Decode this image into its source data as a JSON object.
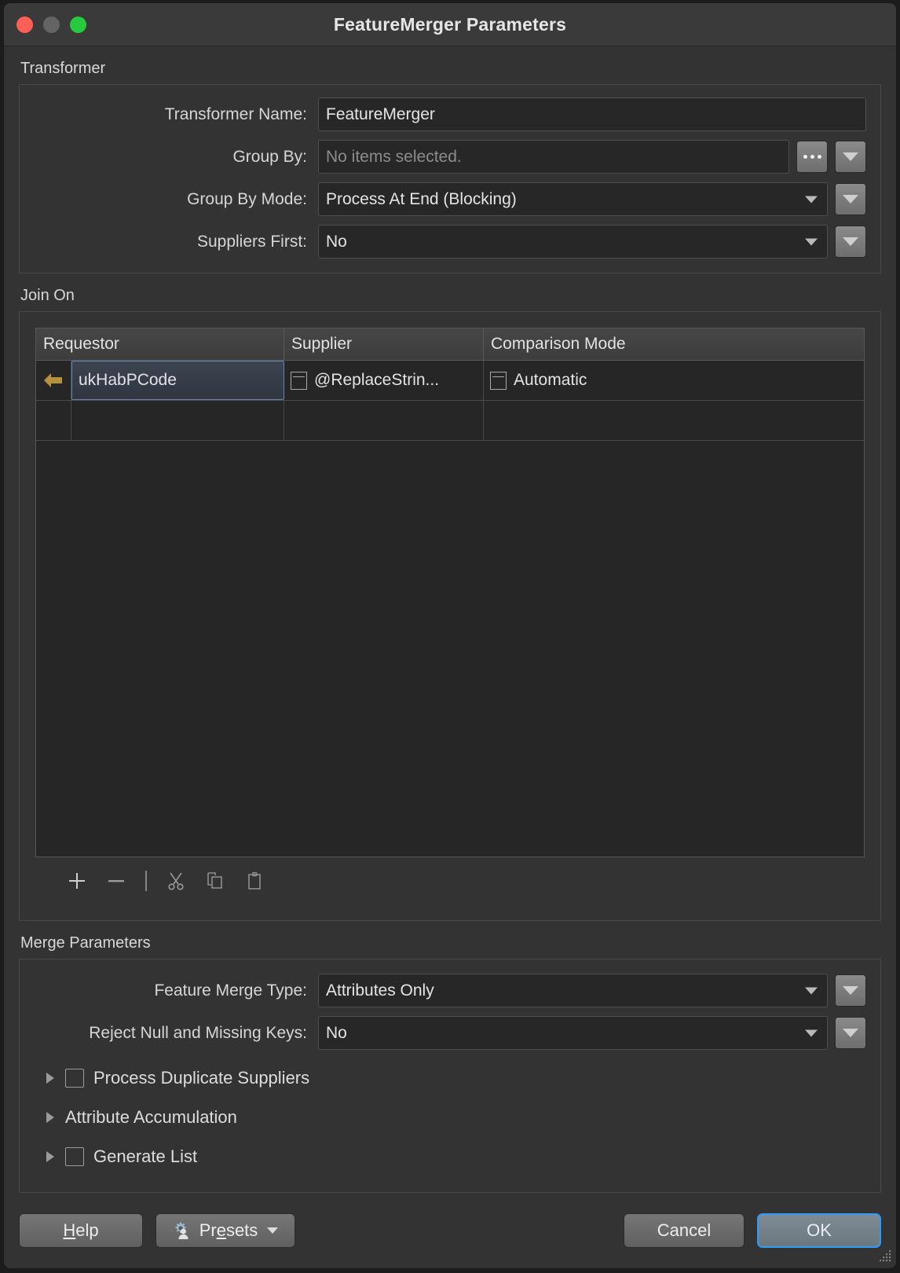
{
  "window": {
    "title": "FeatureMerger Parameters",
    "traffic_lights": [
      "close-button",
      "minimize-button",
      "maximize-button"
    ],
    "accent_focus": "#2f9bf5"
  },
  "transformer": {
    "section_title": "Transformer",
    "fields": [
      {
        "label": "Transformer Name:",
        "value": "FeatureMerger",
        "type": "text"
      },
      {
        "label": "Group By:",
        "value": "",
        "placeholder": "No items selected.",
        "type": "picker",
        "browse_label": "..."
      },
      {
        "label": "Group By Mode:",
        "value": "Process At End (Blocking)",
        "type": "combo"
      },
      {
        "label": "Suppliers First:",
        "value": "No",
        "type": "combo"
      }
    ]
  },
  "join_on": {
    "section_title": "Join On",
    "columns": [
      "Requestor",
      "Supplier",
      "Comparison Mode"
    ],
    "rows": [
      {
        "requestor": "ukHabPCode",
        "supplier": "@ReplaceStrin...",
        "comparison_mode": "Automatic",
        "selected_cell": "requestor",
        "row_marker": "left-arrow-marker"
      }
    ],
    "toolbar": [
      {
        "name": "add-row-button",
        "icon": "plus-icon"
      },
      {
        "name": "remove-row-button",
        "icon": "minus-icon"
      },
      {
        "name": "toolbar-separator",
        "icon": "separator"
      },
      {
        "name": "cut-button",
        "icon": "scissors-icon"
      },
      {
        "name": "copy-button",
        "icon": "copy-icon"
      },
      {
        "name": "paste-button",
        "icon": "clipboard-icon"
      }
    ]
  },
  "merge_parameters": {
    "section_title": "Merge Parameters",
    "fields": [
      {
        "label": "Feature Merge Type:",
        "value": "Attributes Only",
        "type": "combo"
      },
      {
        "label": "Reject Null and Missing Keys:",
        "value": "No",
        "type": "combo"
      }
    ],
    "tree_items": [
      {
        "label": "Process Duplicate Suppliers",
        "checkbox": true,
        "checked": false,
        "expanded": false
      },
      {
        "label": "Attribute Accumulation",
        "checkbox": false,
        "checked": false,
        "expanded": false
      },
      {
        "label": "Generate List",
        "checkbox": true,
        "checked": false,
        "expanded": false
      }
    ]
  },
  "footer": {
    "help_label": "Help",
    "help_mnemonic": "H",
    "presets_label": "Presets",
    "cancel_label": "Cancel",
    "ok_label": "OK"
  }
}
